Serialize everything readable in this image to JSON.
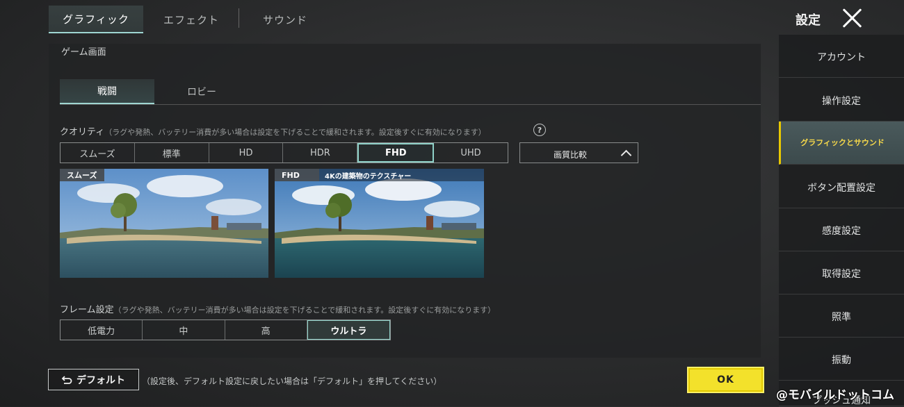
{
  "top_tabs": [
    {
      "label": "グラフィック",
      "active": true
    },
    {
      "label": "エフェクト",
      "active": false
    },
    {
      "label": "サウンド",
      "active": false
    }
  ],
  "header": {
    "title": "設定",
    "close_icon": "close-icon"
  },
  "game_screen": {
    "section_title": "ゲーム画面",
    "sub_tabs": [
      {
        "label": "戦闘",
        "active": true
      },
      {
        "label": "ロビー",
        "active": false
      }
    ]
  },
  "quality": {
    "label": "クオリティ",
    "note": "（ラグや発熱、バッテリー消費が多い場合は設定を下げることで緩和されます。設定後すぐに有効になります）",
    "help_icon": "help-icon",
    "options": [
      "スムーズ",
      "標準",
      "HD",
      "HDR",
      "FHD",
      "UHD"
    ],
    "selected": "FHD",
    "compare_label": "画質比較"
  },
  "preview": {
    "left_label": "スムーズ",
    "right_label": "FHD",
    "right_caption": "4Kの建築物のテクスチャー"
  },
  "frame": {
    "label": "フレーム設定",
    "note": "（ラグや発熱、バッテリー消費が多い場合は設定を下げることで緩和されます。設定後すぐに有効になります）",
    "options": [
      "低電力",
      "中",
      "高",
      "ウルトラ"
    ],
    "selected": "ウルトラ"
  },
  "footer": {
    "default_label": "デフォルト",
    "default_note": "（設定後、デフォルト設定に戻したい場合は「デフォルト」を押してください）",
    "ok_label": "OK"
  },
  "sidebar": {
    "items": [
      {
        "label": "アカウント",
        "active": false
      },
      {
        "label": "操作設定",
        "active": false
      },
      {
        "label": "グラフィックとサウンド",
        "active": true
      },
      {
        "label": "ボタン配置設定",
        "active": false
      },
      {
        "label": "感度設定",
        "active": false
      },
      {
        "label": "取得設定",
        "active": false
      },
      {
        "label": "照準",
        "active": false
      },
      {
        "label": "振動",
        "active": false
      },
      {
        "label": "プッシュ通知",
        "active": false
      }
    ]
  },
  "watermark": "@モバイルドットコム",
  "colors": {
    "accent": "#8fd1c8",
    "ok": "#f3e12b",
    "sidebar_active_text": "#f7d94a"
  }
}
